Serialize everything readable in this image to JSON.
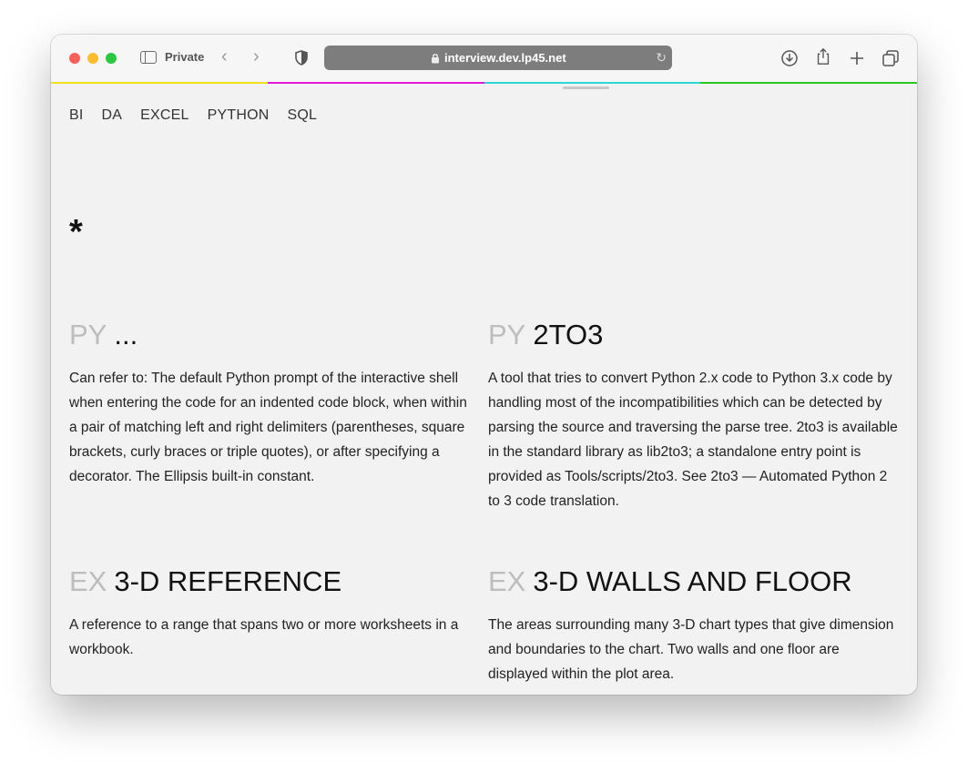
{
  "browser": {
    "private_label": "Private",
    "url": "interview.dev.lp45.net",
    "strip_colors": [
      "#f0e01a",
      "#e01ad8",
      "#2ad8d8",
      "#28c820"
    ]
  },
  "nav": {
    "items": [
      "BI",
      "DA",
      "EXCEL",
      "PYTHON",
      "SQL"
    ]
  },
  "section_marker": "*",
  "entries": [
    {
      "prefix": "PY",
      "term": "...",
      "definition": "Can refer to: The default Python prompt of the interactive shell when entering the code for an indented code block, when within a pair of matching left and right delimiters (parentheses, square brackets, curly braces or triple quotes), or after specifying a decorator. The Ellipsis built-in constant."
    },
    {
      "prefix": "PY",
      "term": "2TO3",
      "definition": "A tool that tries to convert Python 2.x code to Python 3.x code by handling most of the incompatibilities which can be detected by parsing the source and traversing the parse tree. 2to3 is available in the standard library as lib2to3; a standalone entry point is provided as Tools/scripts/2to3. See 2to3 — Automated Python 2 to 3 code translation."
    },
    {
      "prefix": "EX",
      "term": "3-D REFERENCE",
      "definition": "A reference to a range that spans two or more worksheets in a workbook."
    },
    {
      "prefix": "EX",
      "term": "3-D WALLS AND FLOOR",
      "definition": "The areas surrounding many 3-D chart types that give dimension and boundaries to the chart. Two walls and one floor are displayed within the plot area."
    }
  ]
}
